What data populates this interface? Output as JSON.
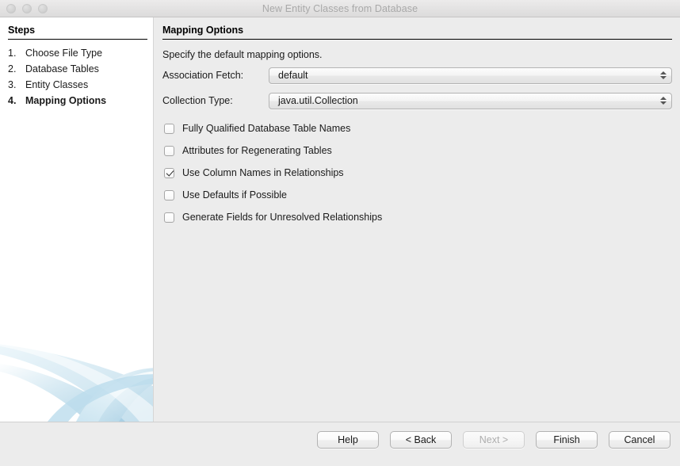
{
  "window": {
    "title": "New Entity Classes from Database",
    "traffic_lights": [
      "close-light",
      "minimize-light",
      "zoom-light"
    ]
  },
  "sidebar": {
    "heading": "Steps",
    "steps": [
      {
        "number": "1.",
        "label": "Choose File Type",
        "current": false
      },
      {
        "number": "2.",
        "label": "Database Tables",
        "current": false
      },
      {
        "number": "3.",
        "label": "Entity Classes",
        "current": false
      },
      {
        "number": "4.",
        "label": "Mapping Options",
        "current": true
      }
    ],
    "decoration": "blue-swoosh-graphic"
  },
  "content": {
    "panel_title": "Mapping Options",
    "description": "Specify the default mapping options.",
    "fields": [
      {
        "label": "Association Fetch:",
        "value": "default",
        "name": "association-fetch-combo"
      },
      {
        "label": "Collection Type:",
        "value": "java.util.Collection",
        "name": "collection-type-combo"
      }
    ],
    "checkboxes": [
      {
        "label": "Fully Qualified Database Table Names",
        "checked": false,
        "name": "checkbox-fully-qualified-table-names"
      },
      {
        "label": "Attributes for Regenerating Tables",
        "checked": false,
        "name": "checkbox-attributes-regenerating-tables"
      },
      {
        "label": "Use Column Names in Relationships",
        "checked": true,
        "name": "checkbox-use-column-names"
      },
      {
        "label": "Use Defaults if Possible",
        "checked": false,
        "name": "checkbox-use-defaults"
      },
      {
        "label": "Generate Fields for Unresolved Relationships",
        "checked": false,
        "name": "checkbox-generate-unresolved-fields"
      }
    ]
  },
  "footer": {
    "buttons": [
      {
        "label": "Help",
        "name": "help-button",
        "disabled": false
      },
      {
        "label": "< Back",
        "name": "back-button",
        "disabled": false
      },
      {
        "label": "Next >",
        "name": "next-button",
        "disabled": true
      },
      {
        "label": "Finish",
        "name": "finish-button",
        "disabled": false
      },
      {
        "label": "Cancel",
        "name": "cancel-button",
        "disabled": false
      }
    ]
  },
  "colors": {
    "panel_background": "#ececec",
    "sidebar_background": "#ffffff",
    "text": "#1a1a1a",
    "title_text": "#a9a9a9",
    "disabled_text": "#aeaeae",
    "decoration_blue": "#a9cfe3"
  }
}
